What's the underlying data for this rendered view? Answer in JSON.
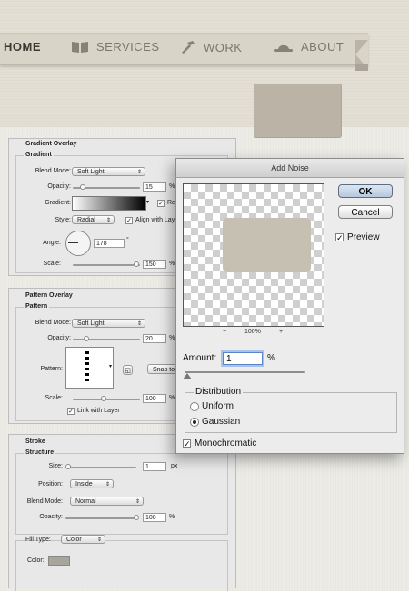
{
  "nav": {
    "items": [
      {
        "label": "HOME",
        "icon": "home"
      },
      {
        "label": "SERVICES",
        "icon": "book-icon"
      },
      {
        "label": "WORK",
        "icon": "hammer-icon"
      },
      {
        "label": "ABOUT",
        "icon": "bowler-hat-icon"
      }
    ]
  },
  "gradient_overlay": {
    "title": "Gradient Overlay",
    "group": "Gradient",
    "blend_mode_label": "Blend Mode:",
    "blend_mode": "Soft Light",
    "opacity_label": "Opacity:",
    "opacity": "15",
    "opacity_unit": "%",
    "gradient_label": "Gradient:",
    "reverse_label": "Re",
    "style_label": "Style:",
    "style": "Radial",
    "align_label": "Align with Lay",
    "angle_label": "Angle:",
    "angle": "178",
    "angle_unit": "°",
    "scale_label": "Scale:",
    "scale": "150",
    "scale_unit": "%"
  },
  "pattern_overlay": {
    "title": "Pattern Overlay",
    "group": "Pattern",
    "blend_mode_label": "Blend Mode:",
    "blend_mode": "Soft Light",
    "opacity_label": "Opacity:",
    "opacity": "20",
    "opacity_unit": "%",
    "pattern_label": "Pattern:",
    "snap_label": "Snap to",
    "scale_label": "Scale:",
    "scale": "100",
    "scale_unit": "%",
    "link_label": "Link with Layer"
  },
  "stroke": {
    "title": "Stroke",
    "group": "Structure",
    "size_label": "Size:",
    "size": "1",
    "size_unit": "px",
    "position_label": "Position:",
    "position": "Inside",
    "blend_mode_label": "Blend Mode:",
    "blend_mode": "Normal",
    "opacity_label": "Opacity:",
    "opacity": "100",
    "opacity_unit": "%",
    "fill_type_label": "Fill Type:",
    "fill_type": "Color",
    "color_label": "Color:"
  },
  "add_noise": {
    "title": "Add Noise",
    "ok": "OK",
    "cancel": "Cancel",
    "preview_label": "Preview",
    "zoom_minus": "−",
    "zoom": "100%",
    "zoom_plus": "+",
    "amount_label": "Amount:",
    "amount": "1",
    "amount_unit": "%",
    "distribution_label": "Distribution",
    "uniform_label": "Uniform",
    "gaussian_label": "Gaussian",
    "monochromatic_label": "Monochromatic"
  },
  "colors": {
    "ribbon": "#d8d4c8",
    "swatch": "#bab3a6",
    "stroke_color": "#a9a49c"
  }
}
